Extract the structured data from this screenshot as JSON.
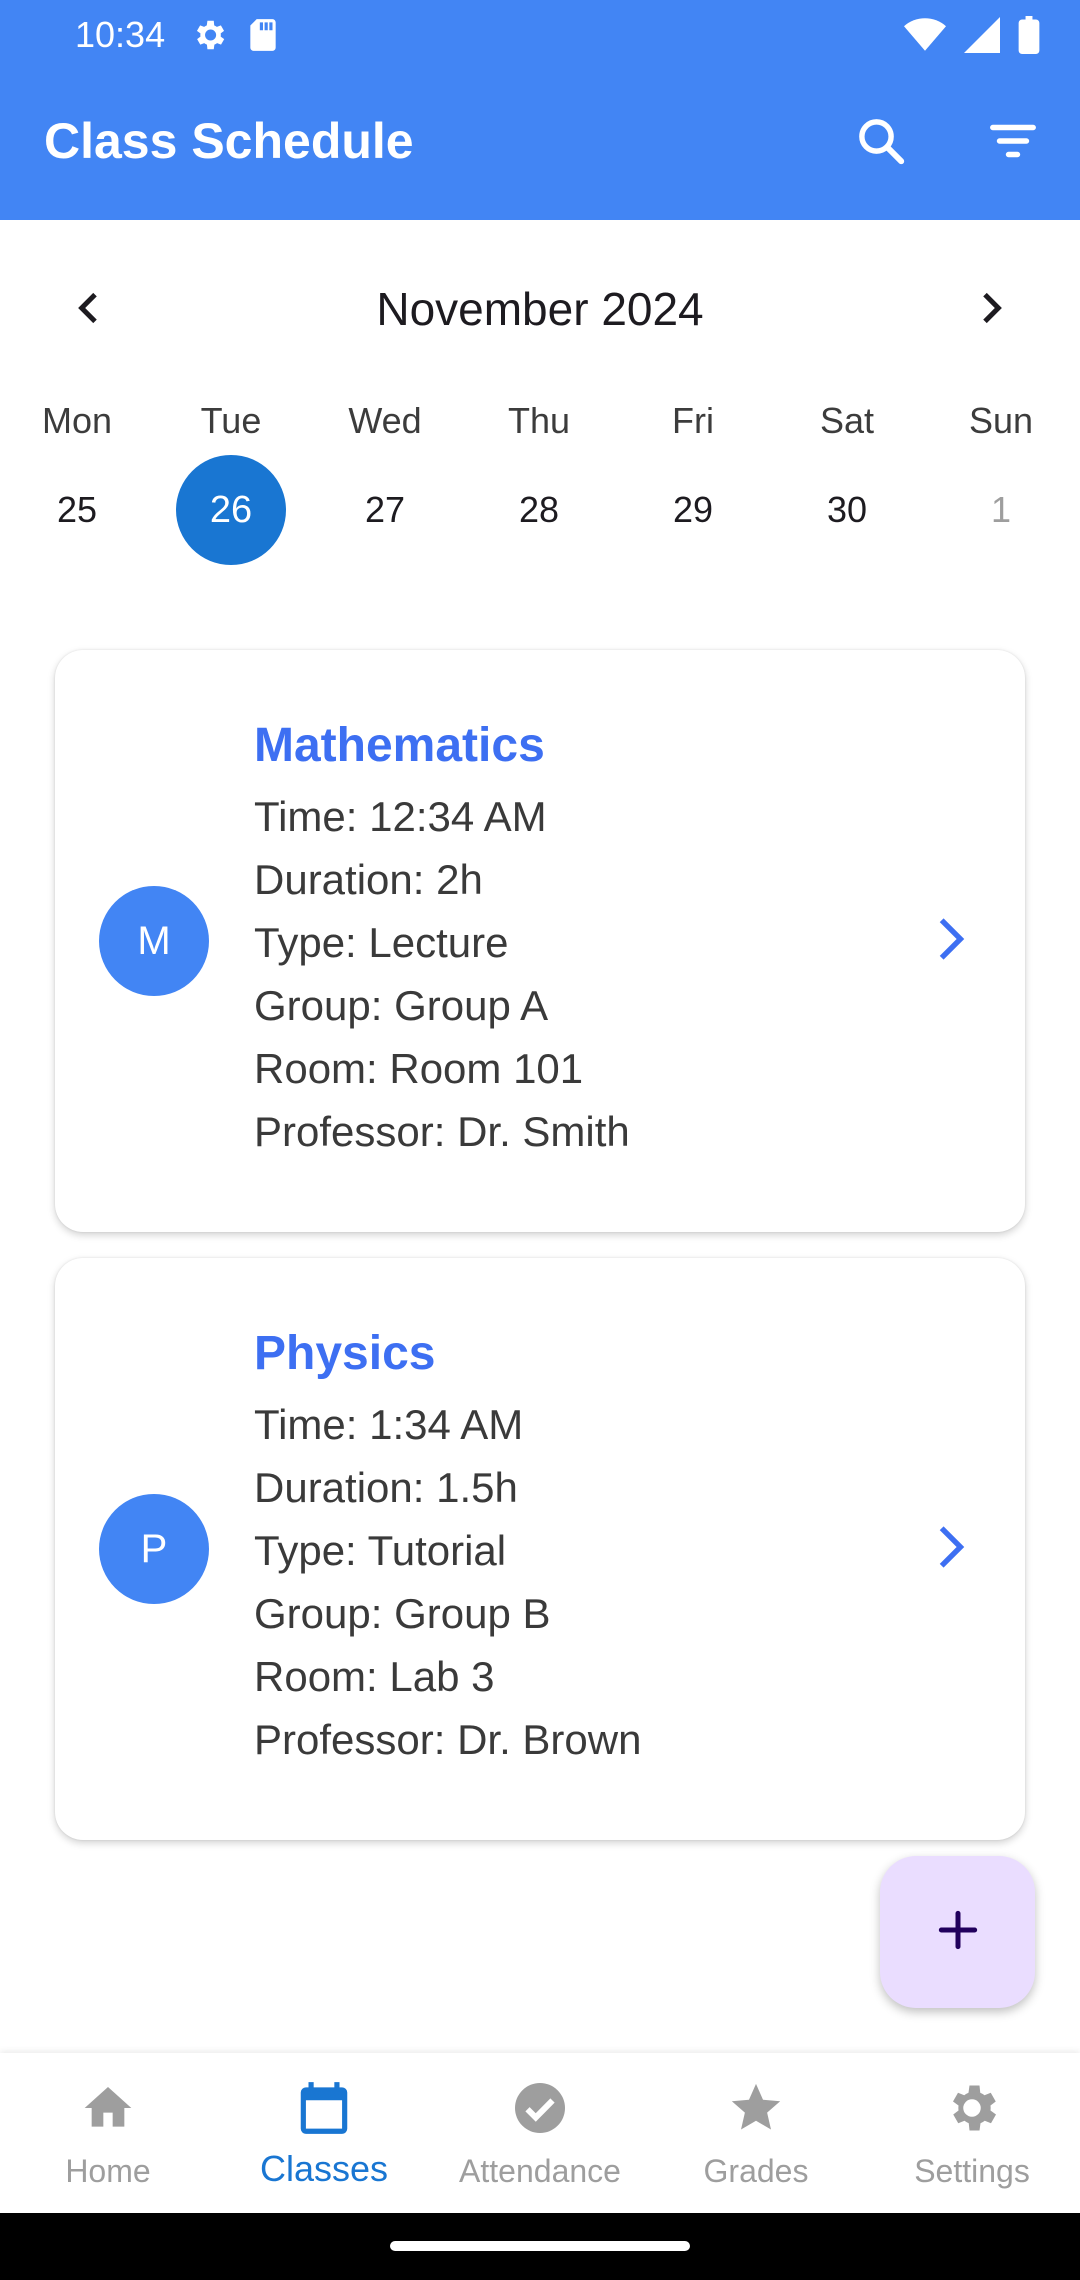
{
  "status_bar": {
    "time": "10:34",
    "left_icons": [
      "gear-icon",
      "sd-card-icon"
    ],
    "right_icons": [
      "wifi-icon",
      "signal-icon",
      "battery-icon"
    ]
  },
  "app_bar": {
    "title": "Class Schedule",
    "actions": [
      "search-icon",
      "filter-icon"
    ],
    "color": "#4285f4"
  },
  "calendar": {
    "month_label": "November 2024",
    "days": [
      {
        "name": "Mon",
        "num": "25",
        "state": "normal"
      },
      {
        "name": "Tue",
        "num": "26",
        "state": "selected"
      },
      {
        "name": "Wed",
        "num": "27",
        "state": "normal"
      },
      {
        "name": "Thu",
        "num": "28",
        "state": "normal"
      },
      {
        "name": "Fri",
        "num": "29",
        "state": "normal"
      },
      {
        "name": "Sat",
        "num": "30",
        "state": "normal"
      },
      {
        "name": "Sun",
        "num": "1",
        "state": "muted"
      }
    ],
    "selected_color": "#1976d2"
  },
  "classes": [
    {
      "initial": "M",
      "name": "Mathematics",
      "time": "Time: 12:34 AM",
      "duration": "Duration: 2h",
      "type": "Type: Lecture",
      "group": "Group: Group A",
      "room": "Room: Room 101",
      "professor": "Professor: Dr. Smith"
    },
    {
      "initial": "P",
      "name": "Physics",
      "time": "Time: 1:34 AM",
      "duration": "Duration: 1.5h",
      "type": "Type: Tutorial",
      "group": "Group: Group B",
      "room": "Room: Lab 3",
      "professor": "Professor: Dr. Brown"
    }
  ],
  "fab": {
    "icon": "plus-icon",
    "color": "#eaddff"
  },
  "bottom_nav": {
    "items": [
      {
        "label": "Home",
        "icon": "home-icon"
      },
      {
        "label": "Classes",
        "icon": "calendar-icon",
        "active": true
      },
      {
        "label": "Attendance",
        "icon": "check-circle-icon"
      },
      {
        "label": "Grades",
        "icon": "star-icon"
      },
      {
        "label": "Settings",
        "icon": "settings-icon"
      }
    ],
    "active_color": "#1976d2"
  }
}
